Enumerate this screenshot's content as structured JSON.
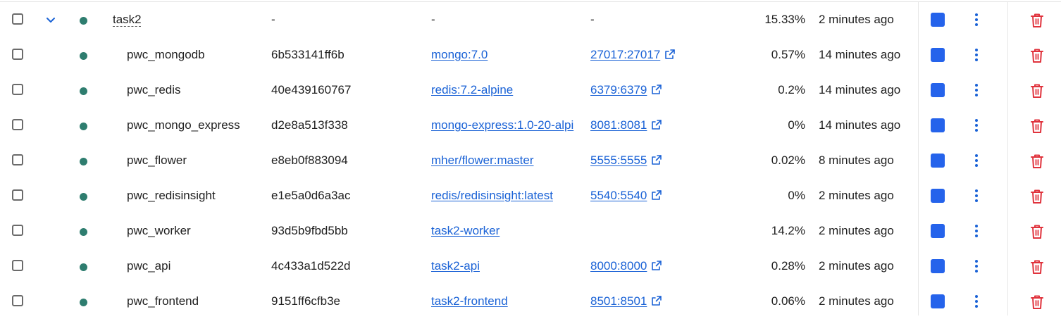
{
  "colors": {
    "status_running": "#2e7d6f",
    "link": "#1a62d6",
    "stop_button": "#2563eb",
    "delete_icon": "#e0333d"
  },
  "icons": {
    "expand": "chevron-down-icon",
    "status": "status-dot-icon",
    "port_link": "external-link-icon",
    "stop": "stop-icon",
    "more": "kebab-menu-icon",
    "delete": "trash-icon"
  },
  "group": {
    "name": "task2",
    "container_id": "-",
    "image": "-",
    "port": "-",
    "cpu": "15.33%",
    "last_started": "2 minutes ago",
    "expanded": true
  },
  "containers": [
    {
      "name": "pwc_mongodb",
      "container_id": "6b533141ff6b",
      "image": "mongo:7.0",
      "port": "27017:27017",
      "cpu": "0.57%",
      "last_started": "14 minutes ago"
    },
    {
      "name": "pwc_redis",
      "container_id": "40e439160767",
      "image": "redis:7.2-alpine",
      "port": "6379:6379",
      "cpu": "0.2%",
      "last_started": "14 minutes ago"
    },
    {
      "name": "pwc_mongo_express",
      "container_id": "d2e8a513f338",
      "image": "mongo-express:1.0-20-alpi",
      "port": "8081:8081",
      "cpu": "0%",
      "last_started": "14 minutes ago"
    },
    {
      "name": "pwc_flower",
      "container_id": "e8eb0f883094",
      "image": "mher/flower:master",
      "port": "5555:5555",
      "cpu": "0.02%",
      "last_started": "8 minutes ago"
    },
    {
      "name": "pwc_redisinsight",
      "container_id": "e1e5a0d6a3ac",
      "image": "redis/redisinsight:latest",
      "port": "5540:5540",
      "cpu": "0%",
      "last_started": "2 minutes ago"
    },
    {
      "name": "pwc_worker",
      "container_id": "93d5b9fbd5bb",
      "image": "task2-worker",
      "port": "",
      "cpu": "14.2%",
      "last_started": "2 minutes ago"
    },
    {
      "name": "pwc_api",
      "container_id": "4c433a1d522d",
      "image": "task2-api",
      "port": "8000:8000",
      "cpu": "0.28%",
      "last_started": "2 minutes ago"
    },
    {
      "name": "pwc_frontend",
      "container_id": "9151ff6cfb3e",
      "image": "task2-frontend",
      "port": "8501:8501",
      "cpu": "0.06%",
      "last_started": "2 minutes ago"
    }
  ]
}
